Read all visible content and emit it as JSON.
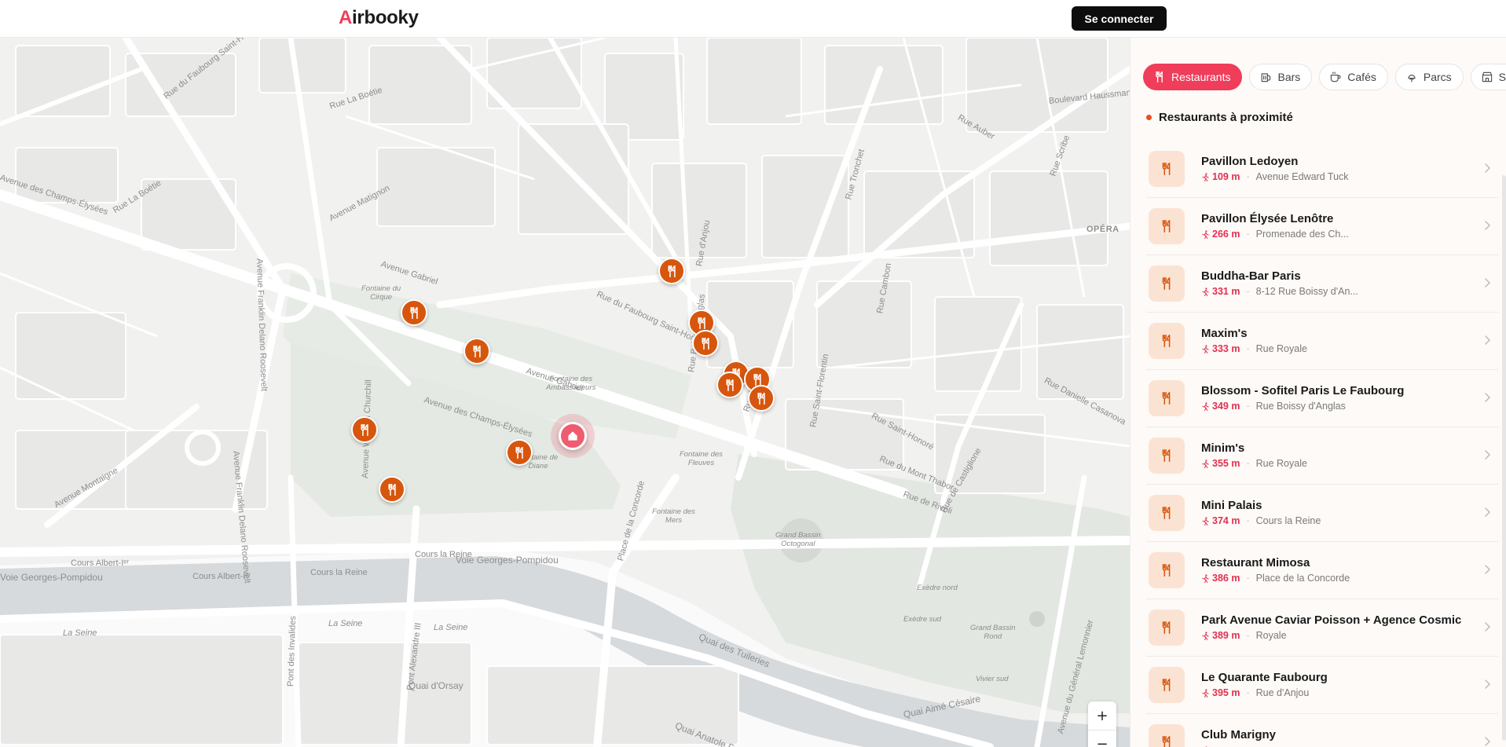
{
  "header": {
    "logo_first": "A",
    "logo_rest": "irbooky",
    "connect_label": "Se connecter"
  },
  "colors": {
    "brand": "#ef3d5a",
    "marker": "#d7560d",
    "distance": "#e3304f"
  },
  "map": {
    "streets": [
      {
        "text": "Rue du Faubourg Saint-Honoré"
      },
      {
        "text": "Rue La Boétie"
      },
      {
        "text": "Avenue des Champs-Élysées"
      },
      {
        "text": "Rue La Boétie"
      },
      {
        "text": "Avenue Matignon"
      },
      {
        "text": "Avenue Gabriel"
      },
      {
        "text": "Avenue Gabriel"
      },
      {
        "text": "Avenue Franklin Delano Roosevelt"
      },
      {
        "text": "Avenue Franklin Delano Roosevelt"
      },
      {
        "text": "Avenue Winston Churchill"
      },
      {
        "text": "Avenue des Champs-Élysées"
      },
      {
        "text": "Avenue Montaigne"
      },
      {
        "text": "Rue du Faubourg Saint-Honoré"
      },
      {
        "text": "Rue Royale"
      },
      {
        "text": "Place de la Concorde"
      },
      {
        "text": "Rue de Rivoli"
      },
      {
        "text": "Rue Saint-Florentin"
      },
      {
        "text": "Rue de Castiglione"
      },
      {
        "text": "Rue Saint-Honoré"
      },
      {
        "text": "Rue Danielle Casanova"
      },
      {
        "text": "Boulevard Haussmann"
      },
      {
        "text": "Rue Scribe"
      },
      {
        "text": "Rue Tronchet"
      },
      {
        "text": "Rue Auber"
      },
      {
        "text": "OPÉRA"
      },
      {
        "text": "Cours Albert-Iᵉʳ"
      },
      {
        "text": "Cours la Reine"
      },
      {
        "text": "Cours la Reine"
      },
      {
        "text": "Voie Georges-Pompidou"
      },
      {
        "text": "Voie Georges-Pompidou"
      },
      {
        "text": "Cours Albert-Iᵉʳ"
      },
      {
        "text": "La Seine"
      },
      {
        "text": "La Seine"
      },
      {
        "text": "La Seine"
      },
      {
        "text": "Quai d'Orsay"
      },
      {
        "text": "Quai des Tuileries"
      },
      {
        "text": "Quai Anatole France"
      },
      {
        "text": "Quai Aimé Césaire"
      },
      {
        "text": "Pont Alexandre III"
      },
      {
        "text": "Pont des Invalides"
      },
      {
        "text": "Avenue du Général Lemonnier"
      },
      {
        "text": "Rue Boissy d'Anglas"
      },
      {
        "text": "Rue d'Anjou"
      },
      {
        "text": "Rue Cambon"
      },
      {
        "text": "Rue du Mont Thabor"
      }
    ],
    "places": [
      {
        "text": "Fontaine du\nCirque"
      },
      {
        "text": "Fontaine des\nAmbassadeurs"
      },
      {
        "text": "Fontaine des\nFleuves"
      },
      {
        "text": "Fontaine des\nMers"
      },
      {
        "text": "Fontaine de\nDiane"
      },
      {
        "text": "Grand Bassin\nOctogonal"
      },
      {
        "text": "Exèdre nord"
      },
      {
        "text": "Exèdre sud"
      },
      {
        "text": "Grand Bassin\nRond"
      },
      {
        "text": "Vivier sud"
      }
    ],
    "zoom_in": "+",
    "zoom_out": "−"
  },
  "panel": {
    "chips": [
      {
        "label": "Restaurants",
        "icon": "fork-knife-icon",
        "active": true
      },
      {
        "label": "Bars",
        "icon": "beer-icon",
        "active": false
      },
      {
        "label": "Cafés",
        "icon": "coffee-icon",
        "active": false
      },
      {
        "label": "Parcs",
        "icon": "tree-icon",
        "active": false
      },
      {
        "label": "Sup",
        "icon": "store-icon",
        "active": false
      }
    ],
    "section_title": "Restaurants à proximité",
    "items": [
      {
        "name": "Pavillon Ledoyen",
        "distance": "109 m",
        "address": "Avenue Edward Tuck"
      },
      {
        "name": "Pavillon Élysée Lenôtre",
        "distance": "266 m",
        "address": "Promenade des Ch..."
      },
      {
        "name": "Buddha-Bar Paris",
        "distance": "331 m",
        "address": "8-12 Rue Boissy d'An..."
      },
      {
        "name": "Maxim's",
        "distance": "333 m",
        "address": "Rue Royale"
      },
      {
        "name": "Blossom - Sofitel Paris Le Faubourg",
        "distance": "349 m",
        "address": "Rue Boissy d'Anglas"
      },
      {
        "name": "Minim's",
        "distance": "355 m",
        "address": "Rue Royale"
      },
      {
        "name": "Mini Palais",
        "distance": "374 m",
        "address": "Cours la Reine"
      },
      {
        "name": "Restaurant Mimosa",
        "distance": "386 m",
        "address": "Place de la Concorde"
      },
      {
        "name": "Park Avenue Caviar Poisson + Agence Cosmic",
        "distance": "389 m",
        "address": "Royale"
      },
      {
        "name": "Le Quarante Faubourg",
        "distance": "395 m",
        "address": "Rue d'Anjou"
      },
      {
        "name": "Club Marigny",
        "distance": "",
        "address": ""
      }
    ]
  }
}
